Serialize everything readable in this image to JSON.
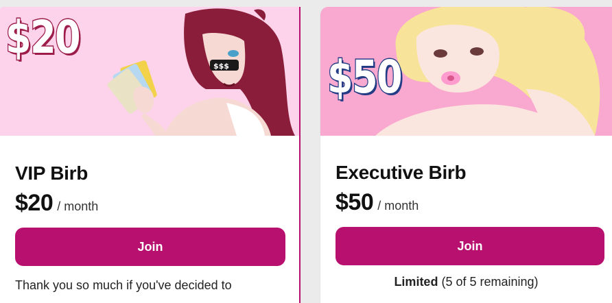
{
  "tiers": [
    {
      "banner_price": "$20",
      "name": "VIP Birb",
      "price": "$20",
      "period": "/ month",
      "join_label": "Join",
      "description": "Thank you so much if you've decided to"
    },
    {
      "banner_price": "$50",
      "name": "Executive Birb",
      "price": "$50",
      "period": "/ month",
      "join_label": "Join",
      "limited_label": "Limited",
      "limited_detail": "(5 of 5 remaining)"
    }
  ],
  "colors": {
    "accent": "#b8106e",
    "vip_banner_bg": "#fcd3ea",
    "exec_banner_bg": "#f9a9cf"
  }
}
